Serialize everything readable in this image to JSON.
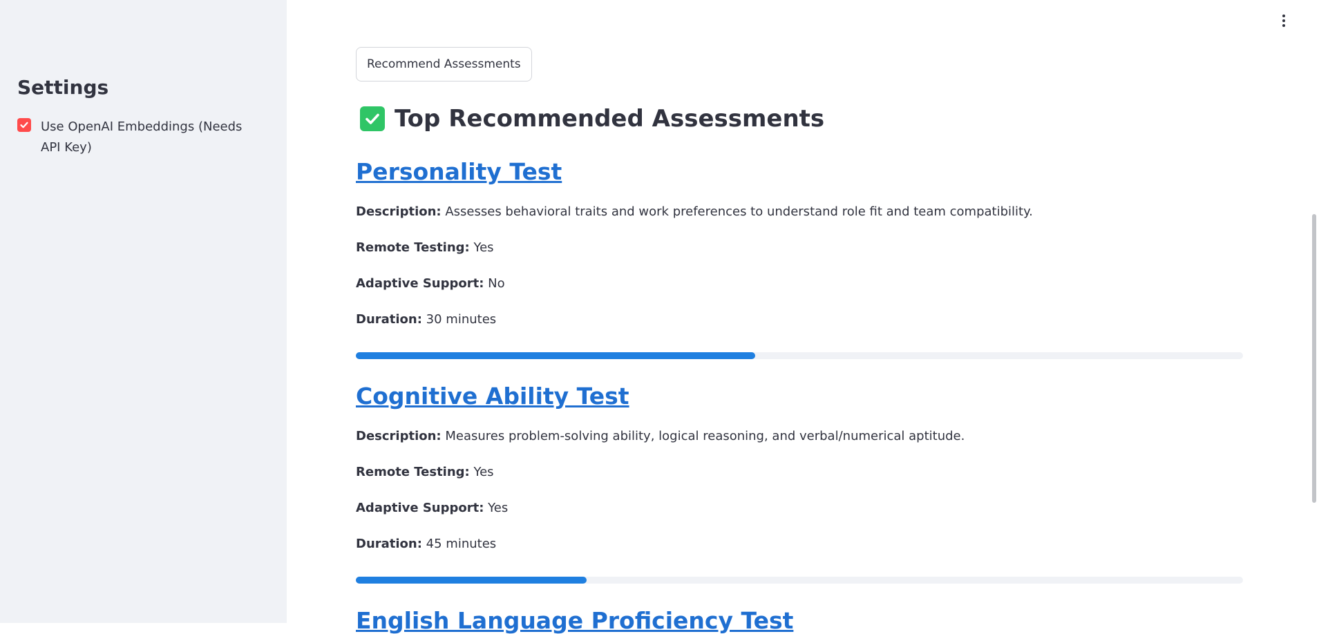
{
  "sidebar": {
    "title": "Settings",
    "checkbox_label": "Use OpenAI Embeddings (Needs API Key)",
    "checkbox_checked": true
  },
  "main": {
    "recommend_button": "Recommend Assessments",
    "heading": "Top Recommended Assessments",
    "accent_color": "#1f7fe0",
    "assessments": [
      {
        "title": "Personality Test",
        "description_label": "Description:",
        "description": "Assesses behavioral traits and work preferences to understand role fit and team compatibility.",
        "remote_label": "Remote Testing:",
        "remote": "Yes",
        "adaptive_label": "Adaptive Support:",
        "adaptive": "No",
        "duration_label": "Duration:",
        "duration": "30 minutes",
        "progress": 0.45
      },
      {
        "title": "Cognitive Ability Test",
        "description_label": "Description:",
        "description": "Measures problem-solving ability, logical reasoning, and verbal/numerical aptitude.",
        "remote_label": "Remote Testing:",
        "remote": "Yes",
        "adaptive_label": "Adaptive Support:",
        "adaptive": "Yes",
        "duration_label": "Duration:",
        "duration": "45 minutes",
        "progress": 0.26
      },
      {
        "title": "English Language Proficiency Test"
      }
    ]
  }
}
